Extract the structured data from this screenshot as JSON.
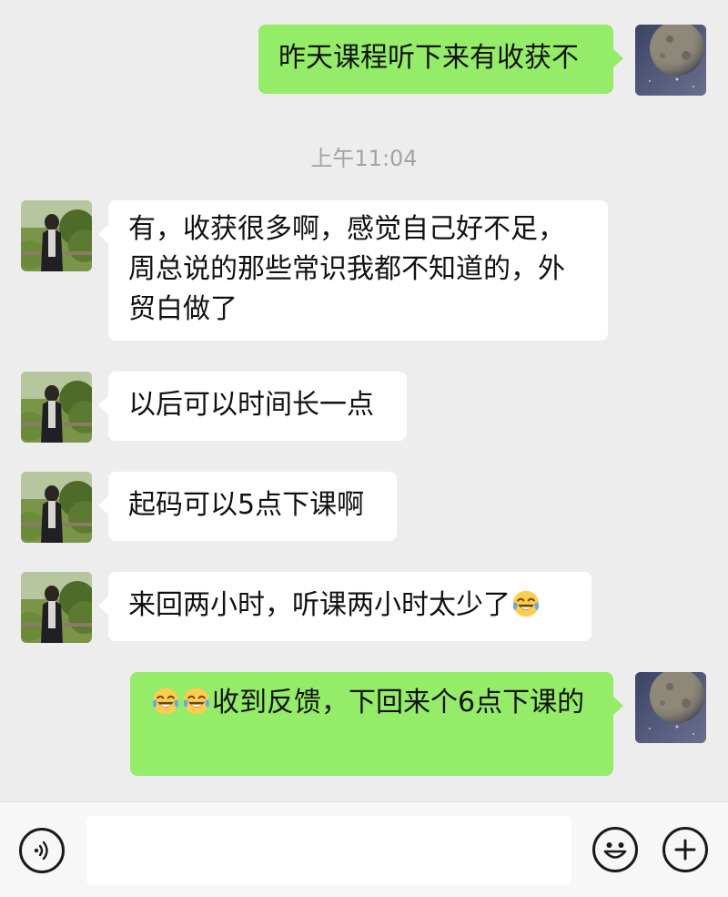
{
  "timestamp": "上午11:04",
  "messages": [
    {
      "text": "昨天课程听下来有收获不"
    },
    {
      "text": "有，收获很多啊，感觉自己好不足，周总说的那些常识我都不知道的，外贸白做了"
    },
    {
      "text": "以后可以时间长一点"
    },
    {
      "text": "起码可以5点下课啊"
    },
    {
      "text": "来回两小时，听课两小时太少了"
    },
    {
      "text": "收到反馈，下回来个6点下课的"
    }
  ],
  "emoji": {
    "name": "tears-of-joy-emoji"
  },
  "colors": {
    "background": "#ededed",
    "outgoing_bubble": "#95ec69",
    "incoming_bubble": "#ffffff",
    "timestamp": "#a3a3a3"
  },
  "input_bar": {
    "value": "",
    "voice_icon": "voice-icon",
    "emoji_icon": "emoji-face-icon",
    "add_icon": "plus-icon"
  }
}
